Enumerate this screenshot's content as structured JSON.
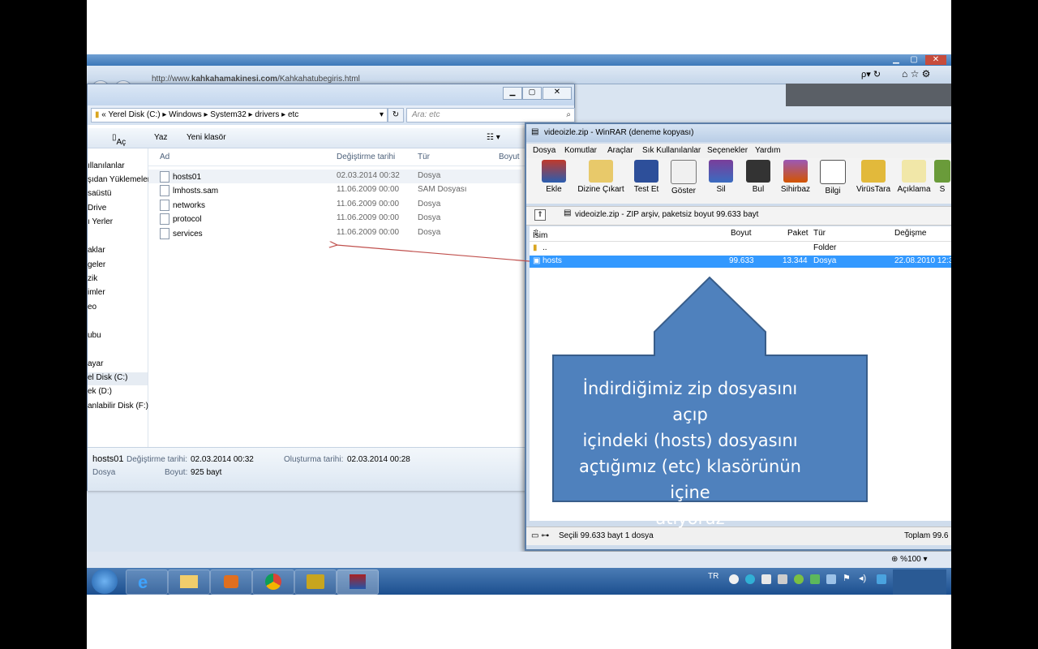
{
  "ie": {
    "url_prefix": "http://www.",
    "url_domain": "kahkahamakinesi.com",
    "url_path": "/Kahkahatubegiris.html",
    "zoom": "%100"
  },
  "explorer": {
    "path": [
      "Yerel Disk (C:)",
      "Windows",
      "System32",
      "drivers",
      "etc"
    ],
    "path_prefix": "«",
    "search_placeholder": "Ara: etc",
    "toolbar": {
      "open": "Aç",
      "print": "Yaz",
      "new_folder": "Yeni klasör"
    },
    "sidebar": [
      "ıllanılanlar",
      "şıdan Yüklemeler",
      "saüstü",
      "Drive",
      "ı Yerler",
      "aklar",
      "geler",
      "zik",
      "imler",
      "eo",
      "ubu",
      "ayar",
      "el Disk (C:)",
      "ek (D:)",
      "anlabilir Disk (F:)"
    ],
    "columns": {
      "name": "Ad",
      "date": "Değiştirme tarihi",
      "type": "Tür",
      "size": "Boyut"
    },
    "files": [
      {
        "name": "hosts01",
        "date": "02.03.2014 00:32",
        "type": "Dosya"
      },
      {
        "name": "lmhosts.sam",
        "date": "11.06.2009 00:00",
        "type": "SAM Dosyası"
      },
      {
        "name": "networks",
        "date": "11.06.2009 00:00",
        "type": "Dosya"
      },
      {
        "name": "protocol",
        "date": "11.06.2009 00:00",
        "type": "Dosya"
      },
      {
        "name": "services",
        "date": "11.06.2009 00:00",
        "type": "Dosya"
      }
    ],
    "status": {
      "name": "hosts01",
      "modified_label": "Değiştirme tarihi:",
      "modified": "02.03.2014 00:32",
      "created_label": "Oluşturma tarihi:",
      "created": "02.03.2014 00:28",
      "type": "Dosya",
      "size_label": "Boyut:",
      "size": "925 bayt"
    }
  },
  "winrar": {
    "title": "videoizle.zip - WinRAR (deneme kopyası)",
    "menu": [
      "Dosya",
      "Komutlar",
      "Araçlar",
      "Sık Kullanılanlar",
      "Seçenekler",
      "Yardım"
    ],
    "toolbar": [
      "Ekle",
      "Dizine Çıkart",
      "Test Et",
      "Göster",
      "Sil",
      "Bul",
      "Sihirbaz",
      "Bilgi",
      "VirüsTara",
      "Açıklama",
      "S"
    ],
    "path": "videoizle.zip - ZIP arşiv, paketsiz boyut 99.633 bayt",
    "columns": {
      "name": "İsim",
      "size": "Boyut",
      "packed": "Paket",
      "type": "Tür",
      "modified": "Değişme"
    },
    "rows": [
      {
        "name": "..",
        "size": "",
        "packed": "",
        "type": "Folder",
        "modified": ""
      },
      {
        "name": "hosts",
        "size": "99.633",
        "packed": "13.344",
        "type": "Dosya",
        "modified": "22.08.2010 12:3"
      }
    ],
    "status_left": "Seçili 99.633 bayt 1 dosya",
    "status_right": "Toplam 99.6"
  },
  "taskbar": {
    "lang": "TR"
  },
  "callout": {
    "lines": [
      "İndirdiğimiz zip dosyasını açıp",
      "içindeki (hosts) dosyasını",
      "açtığımız (etc) klasörünün içine",
      "atıyoruz"
    ],
    "fill": "#4f81bd",
    "stroke": "#385d8a"
  },
  "colors": {
    "selection": "#3399ff",
    "arrow": "#c0504d"
  }
}
